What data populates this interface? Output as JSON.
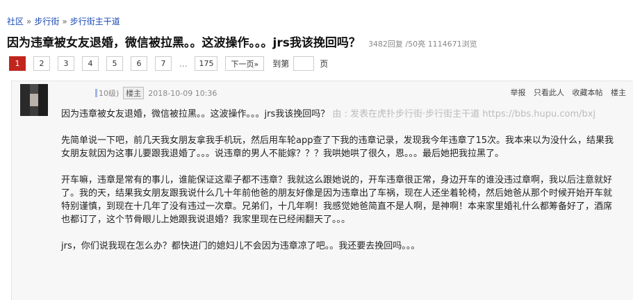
{
  "breadcrumb": {
    "items": [
      "社区",
      "步行街",
      "步行街主干道"
    ],
    "separator": "»"
  },
  "thread": {
    "title": "因为违章被女友退婚，微信被拉黑。。这波操作。。。jrs我该挽回吗？",
    "stats": "3482回复 /50亮  1114671浏览"
  },
  "pagination": {
    "pages": [
      "1",
      "2",
      "3",
      "4",
      "5",
      "6",
      "7"
    ],
    "active": "1",
    "ellipsis": "...",
    "last": "175",
    "next_label": "下一页»",
    "goto_label": "到第",
    "page_unit": "页",
    "goto_value": ""
  },
  "post": {
    "level": "10级)",
    "role": "楼主",
    "timestamp": "2018-10-09 10:36",
    "actions": [
      "举报",
      "只看此人",
      "收藏本帖",
      "楼主"
    ],
    "title_line": "因为违章被女友退婚，微信被拉黑。。这波操作。。。jrs我该挽回吗？",
    "source_prefix": "由 ",
    "source_text": ": 发表在虎扑步行街·步行街主干道 https://bbs.hupu.com/bxj",
    "paragraphs": [
      "先简单说一下吧，前几天我女朋友拿我手机玩，然后用车轮app查了下我的违章记录，发现我今年违章了15次。我本来以为没什么，结果我女朋友就因为这事儿要跟我退婚了。。。说违章的男人不能嫁？？？我哄她哄了很久，恩。。。最后她把我拉黑了。",
      "开车嘛，违章是常有的事儿，谁能保证这辈子都不违章？我就这么跟她说的，开车违章很正常，身边开车的谁没违过章啊，我以后注意就好了。我的天，结果我女朋友跟我说什么几十年前他爸的朋友好像是因为违章出了车祸，现在人还坐着轮椅，然后她爸从那个时候开始开车就特别谨慎，到现在十几年了没有违过一次章。兄弟们，十几年啊！我感觉她爸简直不是人啊，是神啊！本来家里婚礼什么都筹备好了，酒席也都订了，这个节骨眼儿上她跟我说退婚？我家里现在已经闹翻天了。。。",
      "jrs，你们说我现在怎么办？都快进门的媳妇儿不会因为违章凉了吧。。我还要去挽回吗。。。"
    ]
  },
  "colors": {
    "link": "#1a4bb5",
    "active_page": "#c0261d",
    "post_bg": "#f7f7f7"
  }
}
